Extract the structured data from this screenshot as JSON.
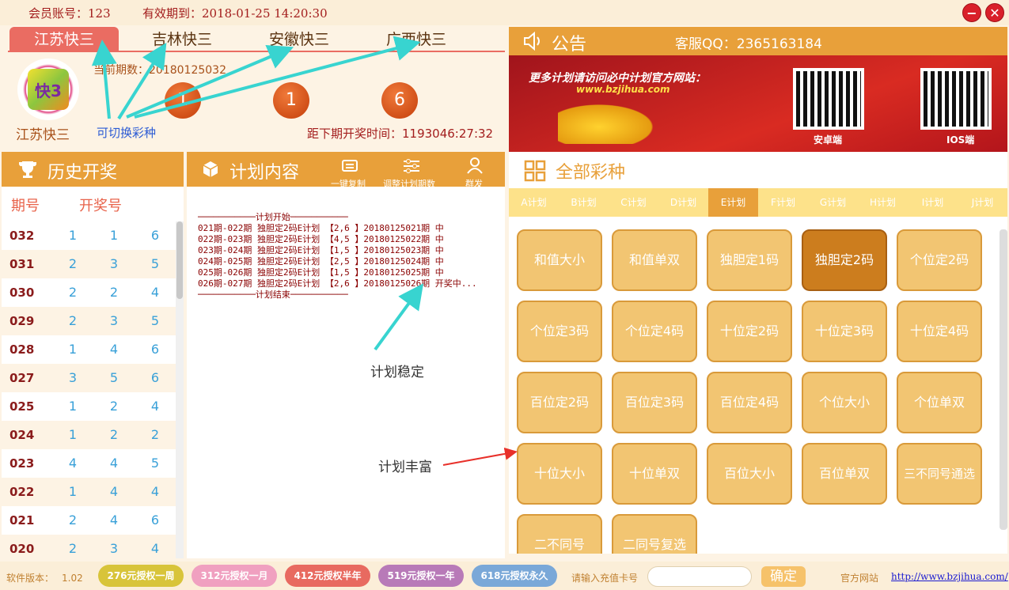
{
  "topbar": {
    "account": "会员账号：123",
    "expiry": "有效期到：2018-01-25 14:20:30",
    "min_icon": "minimize-icon",
    "close_icon": "close-icon"
  },
  "lottery_tabs": [
    "江苏快三",
    "吉林快三",
    "安徽快三",
    "广西快三"
  ],
  "current": {
    "logo_text": "快3",
    "name": "江苏快三",
    "period": "当前期数：20180125032",
    "balls": [
      "1",
      "1",
      "6"
    ],
    "switch_hint": "可切换彩种",
    "countdown": "距下期开奖时间：1193046:27:32"
  },
  "announcement": {
    "title": "公告",
    "qq": "客服QQ：2365163184",
    "banner_text": "更多计划请访问必中计划官方网站：",
    "banner_url": "www.bzjihua.com",
    "qr_android": "安卓端",
    "qr_ios": "IOS端",
    "speaker_icon": "speaker-icon"
  },
  "history": {
    "title": "历史开奖",
    "col_period": "期号",
    "col_numbers": "开奖号",
    "rows": [
      {
        "id": "032",
        "n": [
          "1",
          "1",
          "6"
        ]
      },
      {
        "id": "031",
        "n": [
          "2",
          "3",
          "5"
        ]
      },
      {
        "id": "030",
        "n": [
          "2",
          "2",
          "4"
        ]
      },
      {
        "id": "029",
        "n": [
          "2",
          "3",
          "5"
        ]
      },
      {
        "id": "028",
        "n": [
          "1",
          "4",
          "6"
        ]
      },
      {
        "id": "027",
        "n": [
          "3",
          "5",
          "6"
        ]
      },
      {
        "id": "025",
        "n": [
          "1",
          "2",
          "4"
        ]
      },
      {
        "id": "024",
        "n": [
          "1",
          "2",
          "2"
        ]
      },
      {
        "id": "023",
        "n": [
          "4",
          "4",
          "5"
        ]
      },
      {
        "id": "022",
        "n": [
          "1",
          "4",
          "4"
        ]
      },
      {
        "id": "021",
        "n": [
          "2",
          "4",
          "6"
        ]
      },
      {
        "id": "020",
        "n": [
          "2",
          "3",
          "4"
        ]
      }
    ]
  },
  "plan": {
    "title": "计划内容",
    "btn_copy": "一键复制",
    "btn_adjust": "调整计划期数",
    "btn_broadcast": "群发",
    "lines": [
      "───────────计划开始───────────",
      "021期-022期 独胆定2码E计划 【2,6 】20180125021期 中",
      "022期-023期 独胆定2码E计划 【4,5 】20180125022期 中",
      "023期-024期 独胆定2码E计划 【1,5 】20180125023期 中",
      "024期-025期 独胆定2码E计划 【2,5 】20180125024期 中",
      "025期-026期 独胆定2码E计划 【1,5 】20180125025期 中",
      "026期-027期 独胆定2码E计划 【2,6 】20180125026期 开奖中...",
      "───────────计划结束───────────"
    ],
    "note_stable": "计划稳定",
    "note_rich": "计划丰富"
  },
  "lotteries": {
    "title": "全部彩种",
    "plan_tabs": [
      "A计划",
      "B计划",
      "C计划",
      "D计划",
      "E计划",
      "F计划",
      "G计划",
      "H计划",
      "I计划",
      "J计划"
    ],
    "selected_tab": "E计划",
    "items": [
      "和值大小",
      "和值单双",
      "独胆定1码",
      "独胆定2码",
      "个位定2码",
      "个位定3码",
      "个位定4码",
      "十位定2码",
      "十位定3码",
      "十位定4码",
      "百位定2码",
      "百位定3码",
      "百位定4码",
      "个位大小",
      "个位单双",
      "十位大小",
      "十位单双",
      "百位大小",
      "百位单双",
      "三不同号通选",
      "二不同号",
      "二同号复选"
    ],
    "selected_item": "独胆定2码"
  },
  "bottom": {
    "version_label": "软件版本：",
    "version": "1.02",
    "plans": [
      {
        "label": "276元授权一周",
        "color": "#d8c43a"
      },
      {
        "label": "312元授权一月",
        "color": "#f0a0c0"
      },
      {
        "label": "412元授权半年",
        "color": "#e86a60"
      },
      {
        "label": "519元授权一年",
        "color": "#b87ab8"
      },
      {
        "label": "618元授权永久",
        "color": "#7aa8d8"
      }
    ],
    "card_label": "请输入充值卡号",
    "card_value": "",
    "confirm": "确定",
    "site_label": "官方网站",
    "site_url": "http://www.bzjihua.com/"
  }
}
